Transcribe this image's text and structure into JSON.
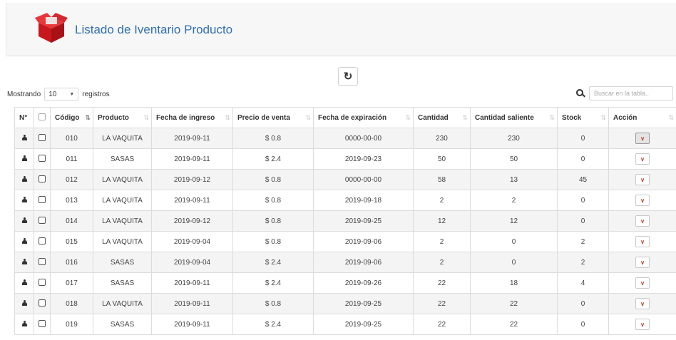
{
  "header": {
    "title": "Listado de Iventario Producto",
    "logo_icon": "box-logo-icon"
  },
  "toolbar": {
    "refresh_icon": "refresh-icon"
  },
  "length_menu": {
    "prefix": "Mostrando",
    "value": "10",
    "suffix": "registros"
  },
  "search": {
    "placeholder": "Buscar en la tabla.."
  },
  "table": {
    "columns": [
      "N°",
      "",
      "Código",
      "Producto",
      "Fecha de ingreso",
      "Precio de venta",
      "Fecha de expiración",
      "Cantidad",
      "Cantidad saliente",
      "Stock",
      "Acción"
    ],
    "rows": [
      {
        "codigo": "010",
        "producto": "LA VAQUITA",
        "ingreso": "2019-09-11",
        "precio": "$ 0.8",
        "expiracion": "0000-00-00",
        "cantidad": "230",
        "saliente": "230",
        "stock": "0"
      },
      {
        "codigo": "011",
        "producto": "SASAS",
        "ingreso": "2019-09-11",
        "precio": "$ 2.4",
        "expiracion": "2019-09-23",
        "cantidad": "50",
        "saliente": "50",
        "stock": "0"
      },
      {
        "codigo": "012",
        "producto": "LA VAQUITA",
        "ingreso": "2019-09-12",
        "precio": "$ 0.8",
        "expiracion": "0000-00-00",
        "cantidad": "58",
        "saliente": "13",
        "stock": "45"
      },
      {
        "codigo": "013",
        "producto": "LA VAQUITA",
        "ingreso": "2019-09-11",
        "precio": "$ 0.8",
        "expiracion": "2019-09-18",
        "cantidad": "2",
        "saliente": "2",
        "stock": "0"
      },
      {
        "codigo": "014",
        "producto": "LA VAQUITA",
        "ingreso": "2019-09-12",
        "precio": "$ 0.8",
        "expiracion": "2019-09-25",
        "cantidad": "12",
        "saliente": "12",
        "stock": "0"
      },
      {
        "codigo": "015",
        "producto": "LA VAQUITA",
        "ingreso": "2019-09-04",
        "precio": "$ 0.8",
        "expiracion": "2019-09-06",
        "cantidad": "2",
        "saliente": "0",
        "stock": "2"
      },
      {
        "codigo": "016",
        "producto": "SASAS",
        "ingreso": "2019-09-04",
        "precio": "$ 2.4",
        "expiracion": "2019-09-06",
        "cantidad": "2",
        "saliente": "0",
        "stock": "2"
      },
      {
        "codigo": "017",
        "producto": "SASAS",
        "ingreso": "2019-09-11",
        "precio": "$ 2.4",
        "expiracion": "2019-09-26",
        "cantidad": "22",
        "saliente": "18",
        "stock": "4"
      },
      {
        "codigo": "018",
        "producto": "LA VAQUITA",
        "ingreso": "2019-09-11",
        "precio": "$ 0.8",
        "expiracion": "2019-09-25",
        "cantidad": "22",
        "saliente": "22",
        "stock": "0"
      },
      {
        "codigo": "019",
        "producto": "SASAS",
        "ingreso": "2019-09-11",
        "precio": "$ 2.4",
        "expiracion": "2019-09-25",
        "cantidad": "22",
        "saliente": "22",
        "stock": "0"
      }
    ]
  },
  "icons": {
    "row_user": "user-icon",
    "action": "chevron-down-icon",
    "search": "search-icon"
  },
  "colors": {
    "title": "#2f6fb0",
    "logo": "#d9262b",
    "action_chevron": "#c0392b"
  }
}
